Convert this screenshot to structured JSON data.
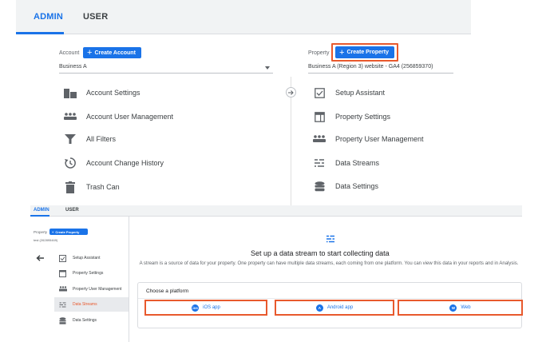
{
  "top": {
    "tabs": {
      "admin": "ADMIN",
      "user": "USER"
    },
    "account": {
      "label": "Account",
      "create_button": "Create Account",
      "selected": "Business A",
      "items": [
        {
          "label": "Account Settings",
          "icon": "account-settings-icon"
        },
        {
          "label": "Account User Management",
          "icon": "people-icon"
        },
        {
          "label": "All Filters",
          "icon": "filter-icon"
        },
        {
          "label": "Account Change History",
          "icon": "history-icon"
        },
        {
          "label": "Trash Can",
          "icon": "trash-icon"
        }
      ]
    },
    "property": {
      "label": "Property",
      "create_button": "Create Property",
      "selected": "Business A (Region 3) website - GA4 (256859370)",
      "items": [
        {
          "label": "Setup Assistant",
          "icon": "checkbox-icon"
        },
        {
          "label": "Property Settings",
          "icon": "property-settings-icon"
        },
        {
          "label": "Property User Management",
          "icon": "people-icon"
        },
        {
          "label": "Data Streams",
          "icon": "data-streams-icon"
        },
        {
          "label": "Data Settings",
          "icon": "database-icon"
        }
      ]
    }
  },
  "bottom": {
    "tabs": {
      "admin": "ADMIN",
      "user": "USER"
    },
    "sidebar": {
      "property_label": "Property",
      "create_button": "Create Property",
      "selected": "test (262895469)",
      "items": [
        {
          "label": "Setup Assistant"
        },
        {
          "label": "Property Settings"
        },
        {
          "label": "Property User Management"
        },
        {
          "label": "Data Streams"
        },
        {
          "label": "Data Settings"
        }
      ]
    },
    "main": {
      "heading": "Set up a data stream to start collecting data",
      "description": "A stream is a source of data for your property. One property can have multiple data streams, each coming from one platform. You can view this data in your reports and in Analysis.",
      "choose_platform": "Choose a platform",
      "platforms": [
        {
          "label": "iOS app",
          "glyph": "🛠"
        },
        {
          "label": "Android app",
          "glyph": "A"
        },
        {
          "label": "Web",
          "glyph": "W"
        }
      ]
    },
    "colors": {
      "accent": "#1a73e8",
      "highlight": "#e8592d",
      "active_row": "#e8eaed"
    }
  }
}
